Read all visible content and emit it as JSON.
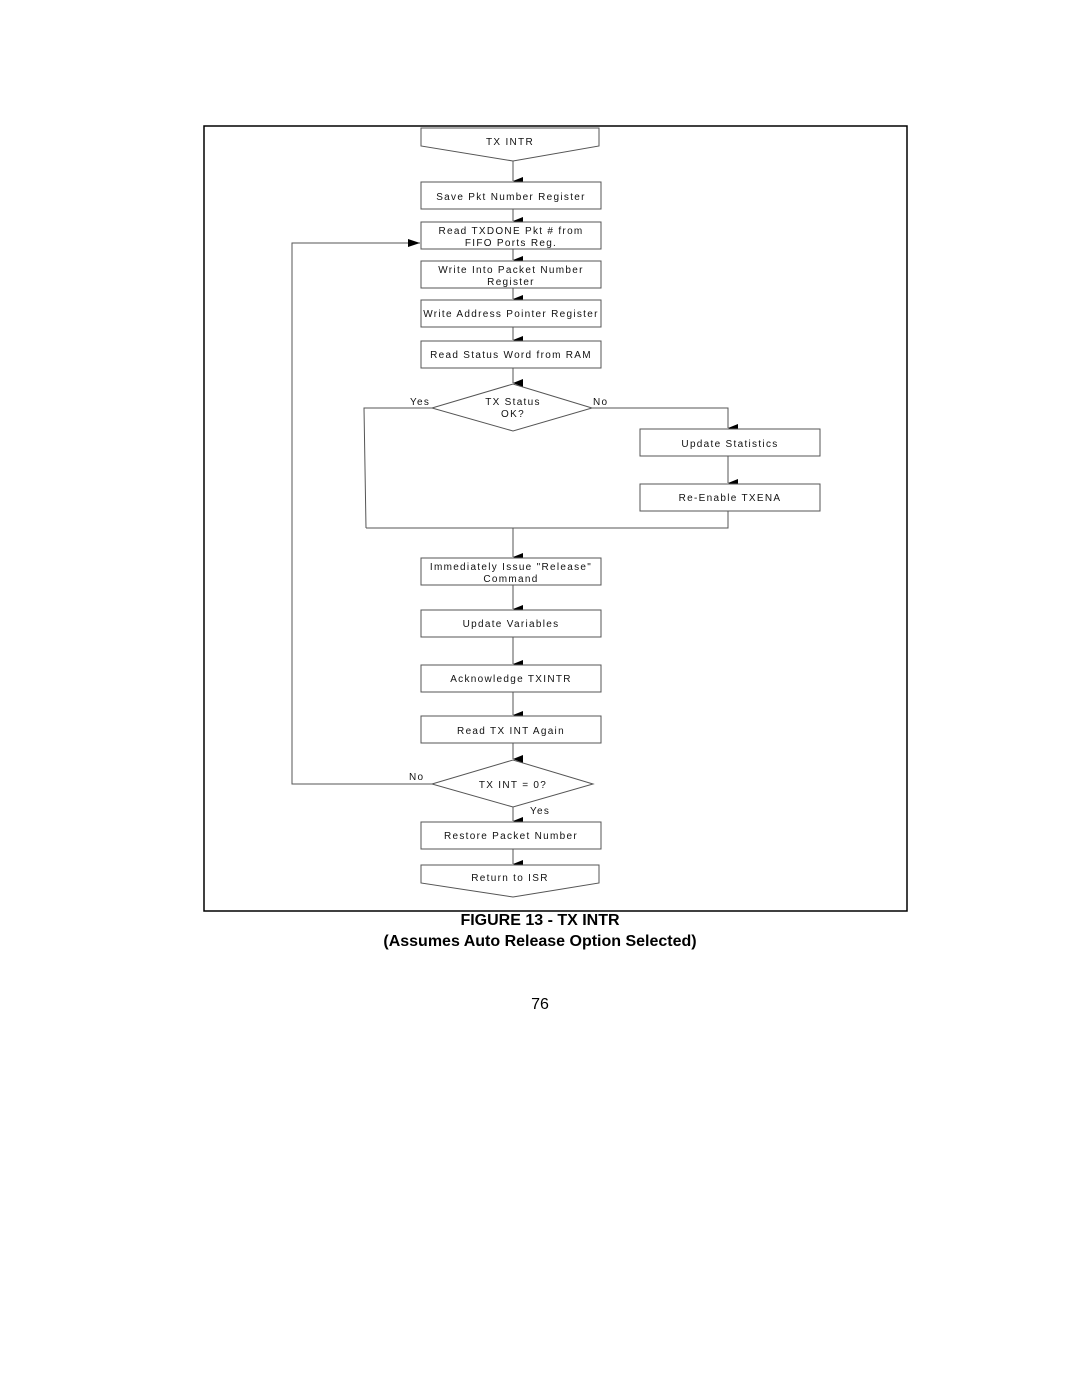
{
  "flowchart": {
    "start": "TX INTR",
    "steps": [
      "Save Pkt Number Register",
      "Read TXDONE Pkt # from",
      "FIFO Ports Reg.",
      "Write Into Packet Number",
      "Register",
      "Write Address Pointer Register",
      "Read Status Word from RAM"
    ],
    "decision1": {
      "line1": "TX Status",
      "line2": "OK?",
      "yes": "Yes",
      "no": "No"
    },
    "no_branch": [
      "Update Statistics",
      "Re-Enable TXENA"
    ],
    "after": [
      "Immediately Issue \"Release\"",
      "Command",
      "Update Variables",
      "Acknowledge TXINTR",
      "Read TX INT Again"
    ],
    "decision2": {
      "text": "TX INT = 0?",
      "yes": "Yes",
      "no": "No"
    },
    "restore": "Restore Packet Number",
    "end": "Return to ISR"
  },
  "caption": {
    "title": "FIGURE 13 - TX INTR",
    "subtitle": "(Assumes Auto Release Option Selected)"
  },
  "page_number": "76"
}
